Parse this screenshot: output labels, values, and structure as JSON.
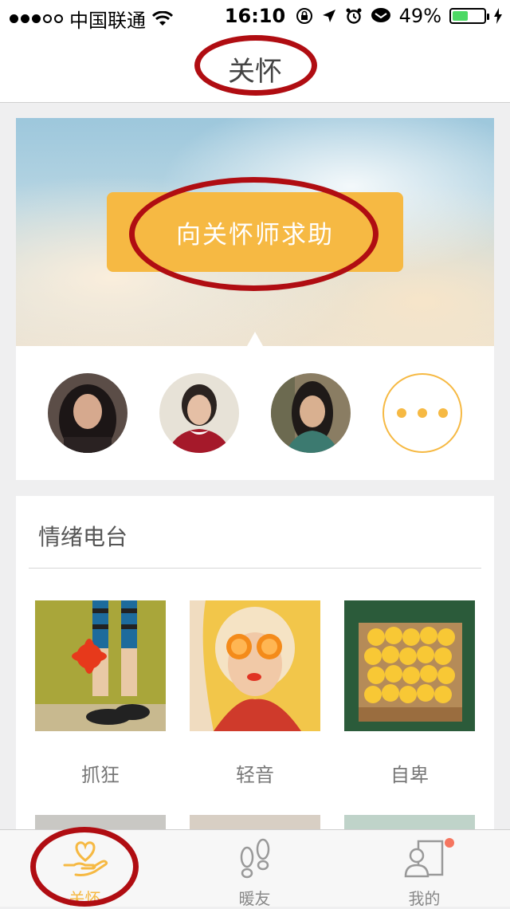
{
  "status_bar": {
    "carrier": "中国联通",
    "time": "16:10",
    "battery": "49%",
    "battery_level": 0.49
  },
  "nav": {
    "title": "关怀"
  },
  "hero": {
    "help_button": "向关怀师求助"
  },
  "counselors": [
    {
      "name": "counselor-1"
    },
    {
      "name": "counselor-2"
    },
    {
      "name": "counselor-3"
    }
  ],
  "radio": {
    "heading": "情绪电台",
    "items": [
      {
        "label": "抓狂"
      },
      {
        "label": "轻音"
      },
      {
        "label": "自卑"
      }
    ]
  },
  "tabbar": {
    "tabs": [
      {
        "label": "关怀",
        "icon": "hand-heart-icon",
        "active": true
      },
      {
        "label": "暖友",
        "icon": "footprints-icon",
        "active": false
      },
      {
        "label": "我的",
        "icon": "profile-icon",
        "active": false,
        "badge": true
      }
    ]
  },
  "colors": {
    "accent": "#f6b943",
    "annotation": "#b00d12",
    "badge": "#f5755f"
  }
}
